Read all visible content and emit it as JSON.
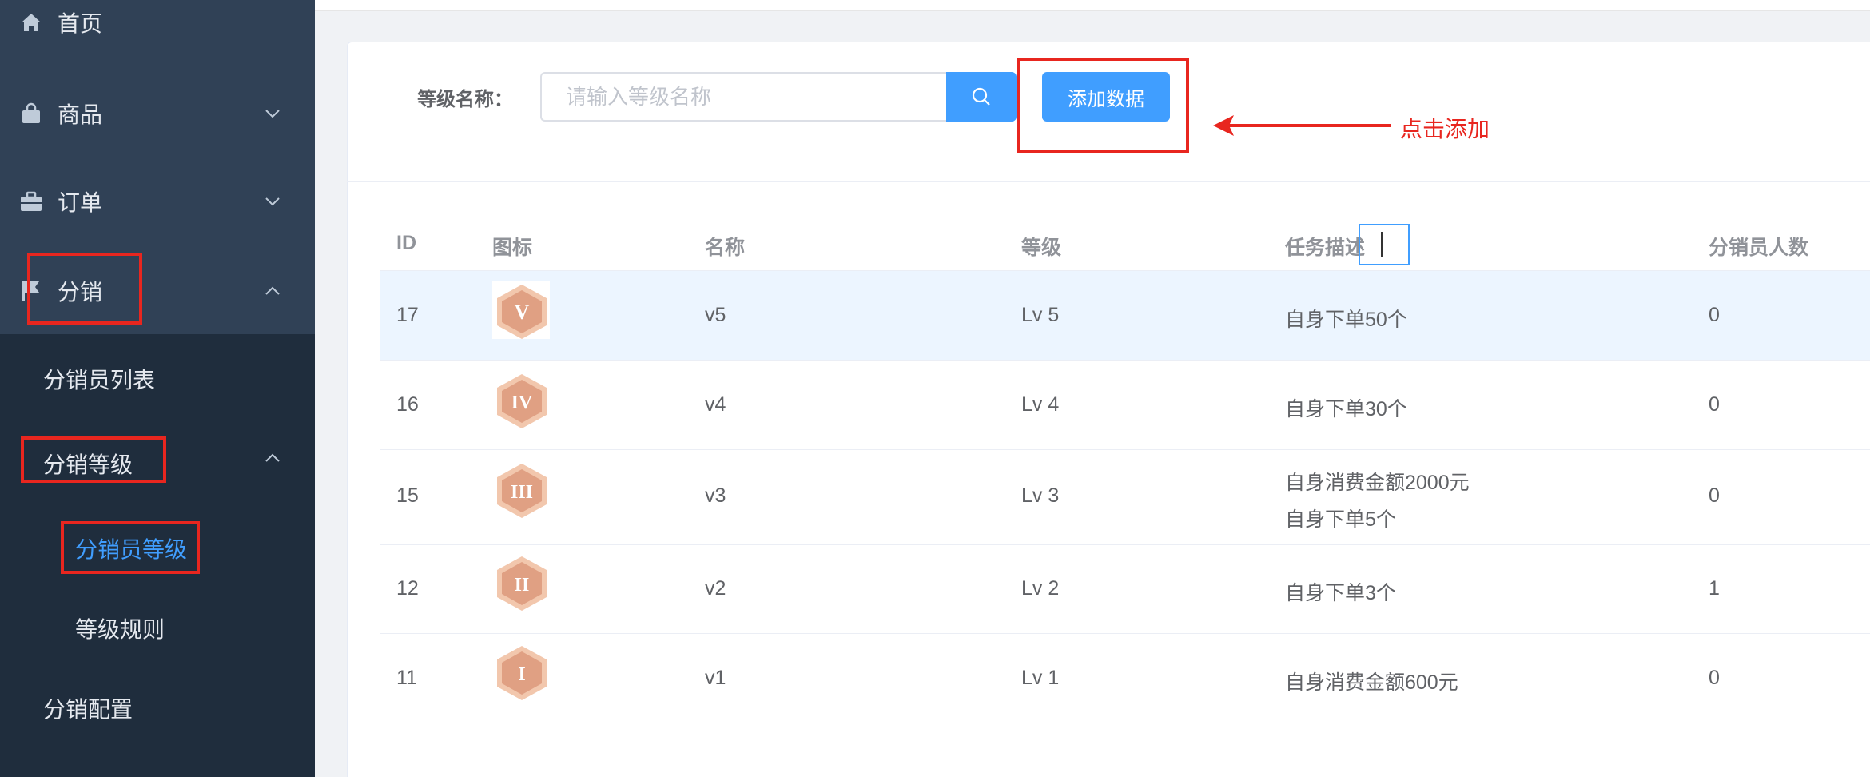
{
  "sidebar": {
    "items": [
      {
        "label": "首页",
        "icon": "home-icon"
      },
      {
        "label": "商品",
        "icon": "shopping-bag-icon"
      },
      {
        "label": "订单",
        "icon": "briefcase-icon"
      },
      {
        "label": "分销",
        "icon": "flag-icon"
      }
    ],
    "submenu": {
      "distributor_list": "分销员列表",
      "distribution_level": "分销等级",
      "distributor_level": "分销员等级",
      "level_rules": "等级规则",
      "distribution_config": "分销配置"
    }
  },
  "search": {
    "label": "等级名称：",
    "placeholder": "请输入等级名称",
    "add_button": "添加数据"
  },
  "annotation": {
    "hint": "点击添加"
  },
  "table": {
    "headers": [
      "ID",
      "图标",
      "名称",
      "等级",
      "任务描述",
      "分销员人数"
    ],
    "rows": [
      {
        "id": "17",
        "badge": "V",
        "name": "v5",
        "level": "Lv 5",
        "task": [
          "自身下单50个"
        ],
        "count": "0"
      },
      {
        "id": "16",
        "badge": "IV",
        "name": "v4",
        "level": "Lv 4",
        "task": [
          "自身下单30个"
        ],
        "count": "0"
      },
      {
        "id": "15",
        "badge": "III",
        "name": "v3",
        "level": "Lv 3",
        "task": [
          "自身消费金额2000元",
          "自身下单5个"
        ],
        "count": "0"
      },
      {
        "id": "12",
        "badge": "II",
        "name": "v2",
        "level": "Lv 2",
        "task": [
          "自身下单3个"
        ],
        "count": "1"
      },
      {
        "id": "11",
        "badge": "I",
        "name": "v1",
        "level": "Lv 1",
        "task": [
          "自身消费金额600元"
        ],
        "count": "0"
      }
    ]
  },
  "colors": {
    "sidebar": "#304156",
    "submenu": "#1f2d3d",
    "primary": "#409eff",
    "annotation": "#e8261f",
    "badge": "#e0a083"
  }
}
